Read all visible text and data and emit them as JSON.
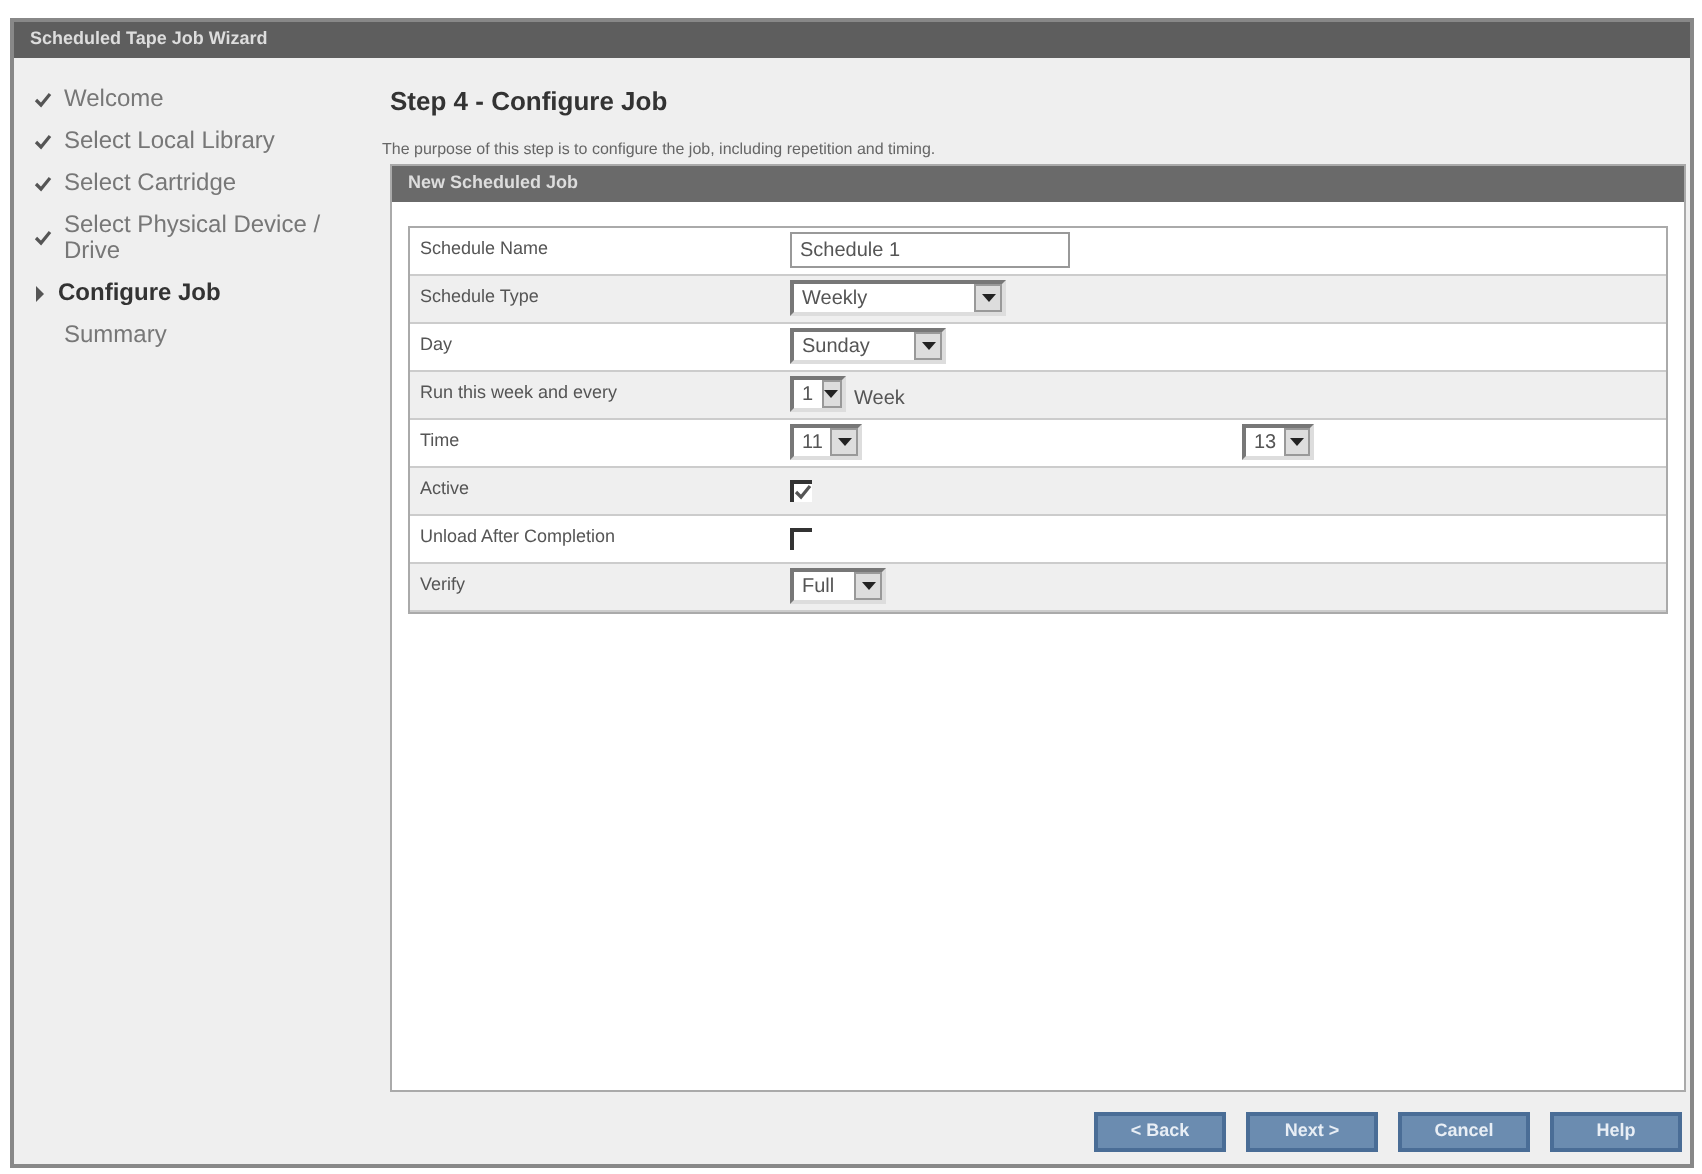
{
  "window": {
    "title": "Scheduled Tape Job Wizard"
  },
  "steps": [
    {
      "label": "Welcome",
      "kind": "done"
    },
    {
      "label": "Select Local Library",
      "kind": "done"
    },
    {
      "label": "Select Cartridge",
      "kind": "done"
    },
    {
      "label": "Select Physical Device / Drive",
      "kind": "done"
    },
    {
      "label": "Configure Job",
      "kind": "current"
    },
    {
      "label": "Summary",
      "kind": "pending"
    }
  ],
  "heading": "Step 4 - Configure Job",
  "description": "The purpose of this step is to configure the job, including repetition and timing.",
  "panel": {
    "title": "New Scheduled Job",
    "rows": [
      {
        "label": "Schedule Name",
        "kind": "text",
        "value": "Schedule 1"
      },
      {
        "label": "Schedule Type",
        "kind": "select",
        "value": "Weekly"
      },
      {
        "label": "Day",
        "kind": "select",
        "value": "Sunday"
      },
      {
        "label": "Run this week and every",
        "kind": "select_unit",
        "value": "1",
        "unit": "Week"
      },
      {
        "label": "Time",
        "kind": "time",
        "value": "11",
        "value_2": "13"
      },
      {
        "label": "Active",
        "kind": "checkbox",
        "checked": true
      },
      {
        "label": "Unload After Completion",
        "kind": "checkbox",
        "checked": false
      },
      {
        "label": "Verify",
        "kind": "select",
        "value": "Full"
      }
    ]
  },
  "buttons": [
    "< Back",
    "Next >",
    "Cancel",
    "Help"
  ]
}
